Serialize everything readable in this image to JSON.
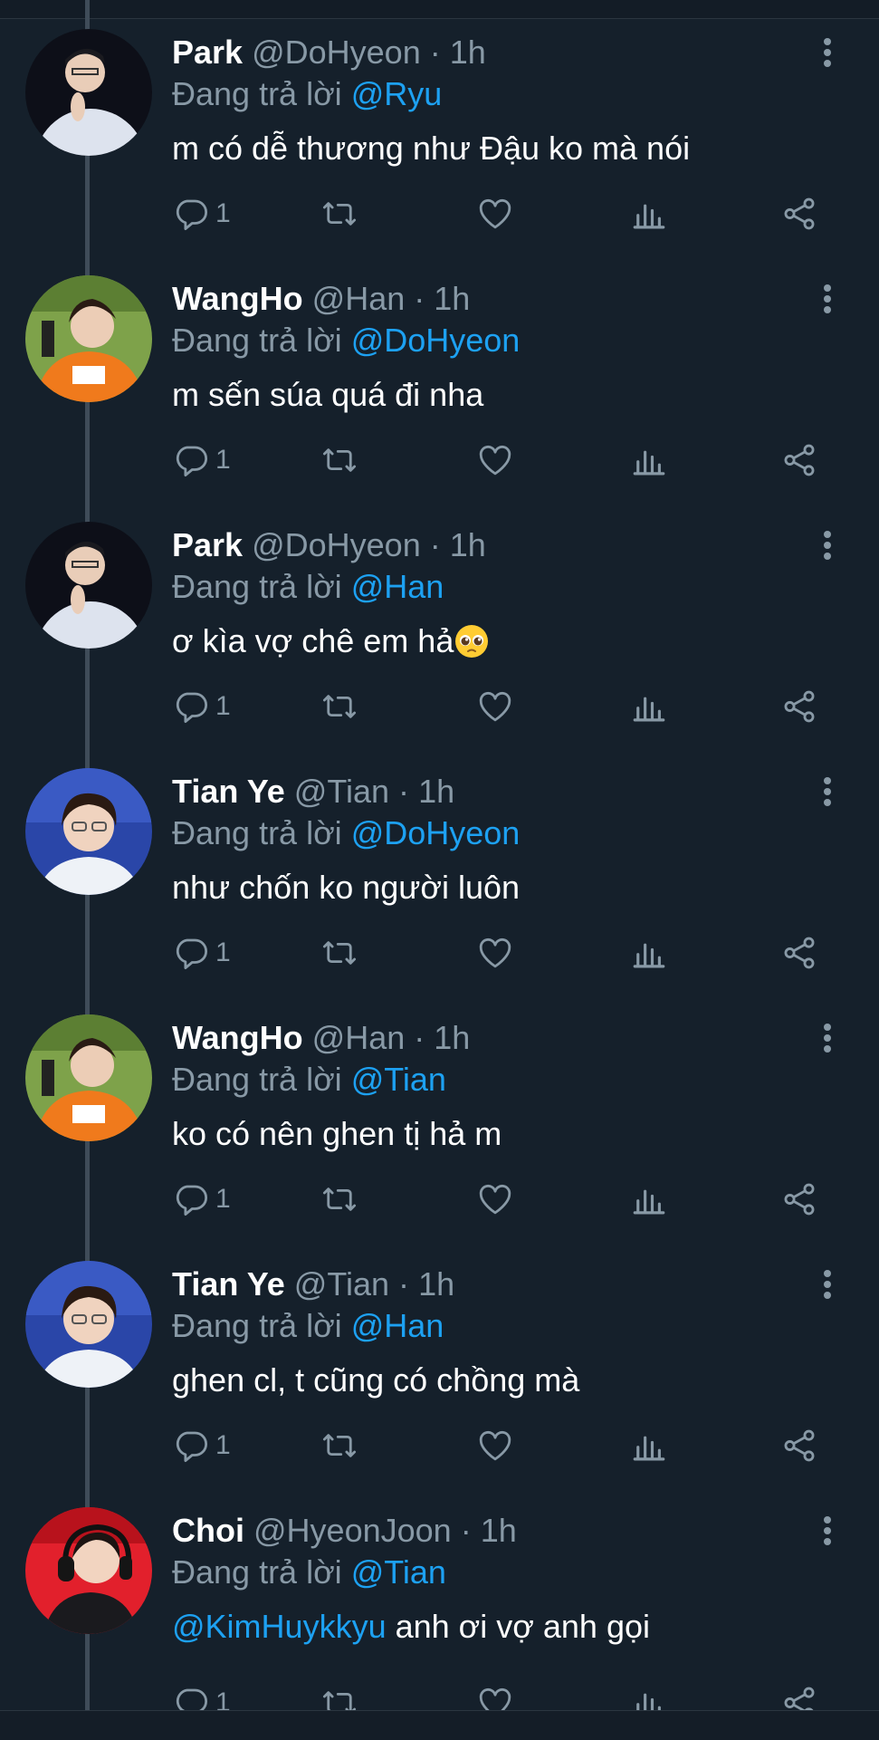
{
  "colors": {
    "background": "#15202b",
    "text_primary": "#ffffff",
    "text_secondary": "#8899a6",
    "link": "#1da1f2",
    "thread_line": "#3f4c59"
  },
  "icons": {
    "reply": "reply-icon",
    "retweet": "retweet-icon",
    "like": "heart-icon",
    "analytics": "analytics-icon",
    "share": "share-icon",
    "more": "more-vertical-icon"
  },
  "reply_prefix": "Đang trả lời",
  "tweets": [
    {
      "name": "Park",
      "handle": "@DoHyeon",
      "dot": "·",
      "time": "1h",
      "reply_to": "@Ryu",
      "text": "m có dễ thương như Đậu ko mà nói",
      "mention": "",
      "emoji": "",
      "reply_count": "1"
    },
    {
      "name": "WangHo",
      "handle": "@Han",
      "dot": "·",
      "time": "1h",
      "reply_to": "@DoHyeon",
      "text": "m sến súa quá đi nha",
      "mention": "",
      "emoji": "",
      "reply_count": "1"
    },
    {
      "name": "Park",
      "handle": "@DoHyeon",
      "dot": "·",
      "time": "1h",
      "reply_to": "@Han",
      "text": "ơ kìa vợ chê em hả",
      "mention": "",
      "emoji": "pleading-face-emoji",
      "reply_count": "1"
    },
    {
      "name": "Tian Ye",
      "handle": "@Tian",
      "dot": "·",
      "time": "1h",
      "reply_to": "@DoHyeon",
      "text": "như chốn ko người luôn",
      "mention": "",
      "emoji": "",
      "reply_count": "1"
    },
    {
      "name": "WangHo",
      "handle": "@Han",
      "dot": "·",
      "time": "1h",
      "reply_to": "@Tian",
      "text": "ko có nên ghen tị hả m",
      "mention": "",
      "emoji": "",
      "reply_count": "1"
    },
    {
      "name": "Tian Ye",
      "handle": "@Tian",
      "dot": "·",
      "time": "1h",
      "reply_to": "@Han",
      "text": "ghen cl, t cũng có chồng mà",
      "mention": "",
      "emoji": "",
      "reply_count": "1"
    },
    {
      "name": "Choi",
      "handle": "@HyeonJoon",
      "dot": "·",
      "time": "1h",
      "reply_to": "@Tian",
      "text": "anh ơi vợ anh gọi",
      "mention": "@KimHuykkyu",
      "emoji": "",
      "reply_count": "1"
    }
  ]
}
